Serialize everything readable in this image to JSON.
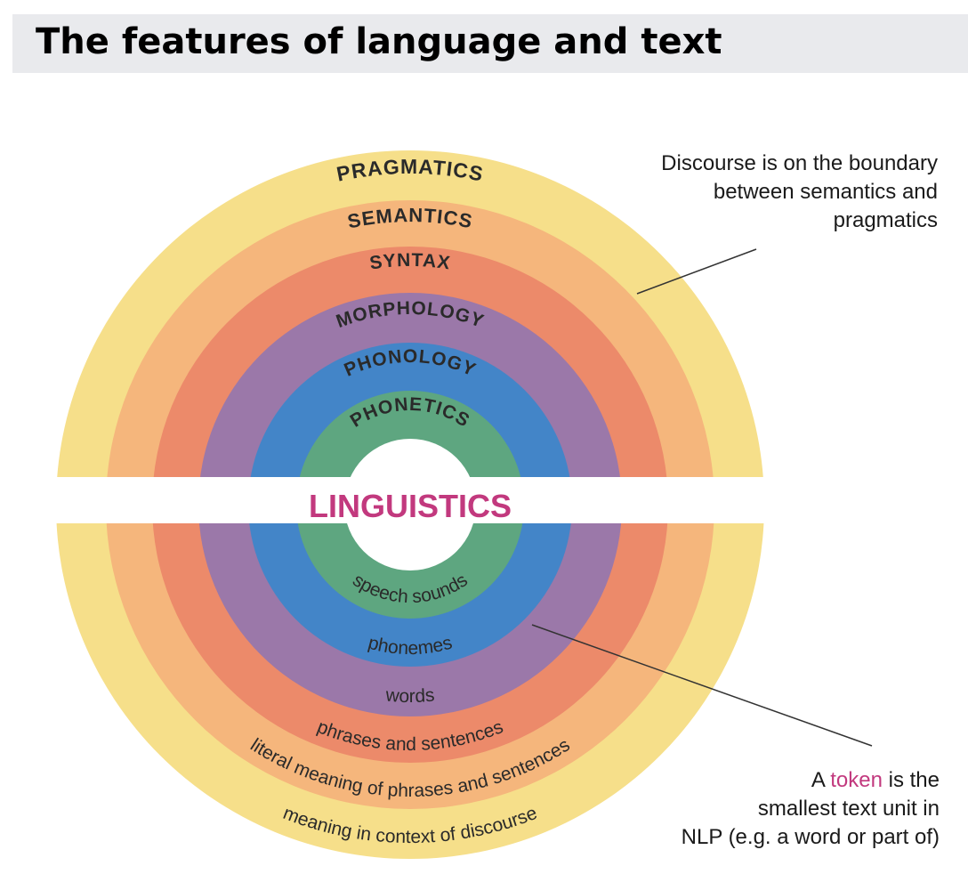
{
  "title": "The features of language and text",
  "center_label": "LINGUISTICS",
  "rings": [
    {
      "name": "PRAGMATICS",
      "description": "meaning in context of discourse",
      "color": "#f6df8a"
    },
    {
      "name": "SEMANTICS",
      "description": "literal meaning of phrases and sentences",
      "color": "#f5b67c"
    },
    {
      "name": "SYNTAX",
      "description": "phrases and sentences",
      "color": "#ec8a6a"
    },
    {
      "name": "MORPHOLOGY",
      "description": "words",
      "color": "#9b78a9"
    },
    {
      "name": "PHONOLOGY",
      "description": "phonemes",
      "color": "#4385c8"
    },
    {
      "name": "PHONETICS",
      "description": "speech sounds",
      "color": "#5ea680"
    }
  ],
  "colors": {
    "center_label": "#c2397e",
    "token": "#c2397e",
    "pointer_line": "#333333"
  },
  "notes": {
    "discourse": [
      "Discourse is on the boundary",
      "between semantics and",
      "pragmatics"
    ],
    "token": {
      "line1_before": "A ",
      "line1_highlight": "token",
      "line1_after": " is the",
      "line2": "smallest text unit in",
      "line3": "NLP (e.g. a word or part of)"
    }
  }
}
